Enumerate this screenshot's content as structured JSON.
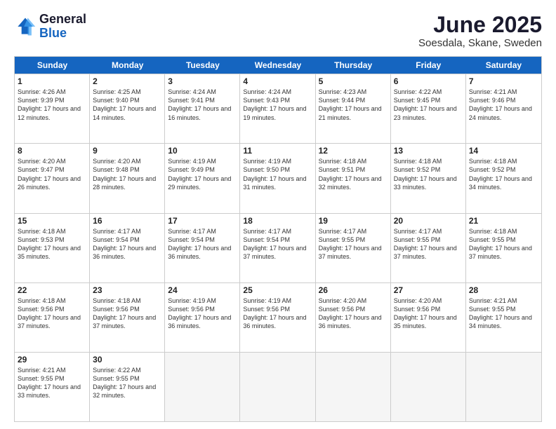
{
  "logo": {
    "general": "General",
    "blue": "Blue"
  },
  "title": "June 2025",
  "location": "Soesdala, Skane, Sweden",
  "weekdays": [
    "Sunday",
    "Monday",
    "Tuesday",
    "Wednesday",
    "Thursday",
    "Friday",
    "Saturday"
  ],
  "weeks": [
    [
      {
        "day": "1",
        "sunrise": "4:26 AM",
        "sunset": "9:39 PM",
        "daylight": "17 hours and 12 minutes."
      },
      {
        "day": "2",
        "sunrise": "4:25 AM",
        "sunset": "9:40 PM",
        "daylight": "17 hours and 14 minutes."
      },
      {
        "day": "3",
        "sunrise": "4:24 AM",
        "sunset": "9:41 PM",
        "daylight": "17 hours and 16 minutes."
      },
      {
        "day": "4",
        "sunrise": "4:24 AM",
        "sunset": "9:43 PM",
        "daylight": "17 hours and 19 minutes."
      },
      {
        "day": "5",
        "sunrise": "4:23 AM",
        "sunset": "9:44 PM",
        "daylight": "17 hours and 21 minutes."
      },
      {
        "day": "6",
        "sunrise": "4:22 AM",
        "sunset": "9:45 PM",
        "daylight": "17 hours and 23 minutes."
      },
      {
        "day": "7",
        "sunrise": "4:21 AM",
        "sunset": "9:46 PM",
        "daylight": "17 hours and 24 minutes."
      }
    ],
    [
      {
        "day": "8",
        "sunrise": "4:20 AM",
        "sunset": "9:47 PM",
        "daylight": "17 hours and 26 minutes."
      },
      {
        "day": "9",
        "sunrise": "4:20 AM",
        "sunset": "9:48 PM",
        "daylight": "17 hours and 28 minutes."
      },
      {
        "day": "10",
        "sunrise": "4:19 AM",
        "sunset": "9:49 PM",
        "daylight": "17 hours and 29 minutes."
      },
      {
        "day": "11",
        "sunrise": "4:19 AM",
        "sunset": "9:50 PM",
        "daylight": "17 hours and 31 minutes."
      },
      {
        "day": "12",
        "sunrise": "4:18 AM",
        "sunset": "9:51 PM",
        "daylight": "17 hours and 32 minutes."
      },
      {
        "day": "13",
        "sunrise": "4:18 AM",
        "sunset": "9:52 PM",
        "daylight": "17 hours and 33 minutes."
      },
      {
        "day": "14",
        "sunrise": "4:18 AM",
        "sunset": "9:52 PM",
        "daylight": "17 hours and 34 minutes."
      }
    ],
    [
      {
        "day": "15",
        "sunrise": "4:18 AM",
        "sunset": "9:53 PM",
        "daylight": "17 hours and 35 minutes."
      },
      {
        "day": "16",
        "sunrise": "4:17 AM",
        "sunset": "9:54 PM",
        "daylight": "17 hours and 36 minutes."
      },
      {
        "day": "17",
        "sunrise": "4:17 AM",
        "sunset": "9:54 PM",
        "daylight": "17 hours and 36 minutes."
      },
      {
        "day": "18",
        "sunrise": "4:17 AM",
        "sunset": "9:54 PM",
        "daylight": "17 hours and 37 minutes."
      },
      {
        "day": "19",
        "sunrise": "4:17 AM",
        "sunset": "9:55 PM",
        "daylight": "17 hours and 37 minutes."
      },
      {
        "day": "20",
        "sunrise": "4:17 AM",
        "sunset": "9:55 PM",
        "daylight": "17 hours and 37 minutes."
      },
      {
        "day": "21",
        "sunrise": "4:18 AM",
        "sunset": "9:55 PM",
        "daylight": "17 hours and 37 minutes."
      }
    ],
    [
      {
        "day": "22",
        "sunrise": "4:18 AM",
        "sunset": "9:56 PM",
        "daylight": "17 hours and 37 minutes."
      },
      {
        "day": "23",
        "sunrise": "4:18 AM",
        "sunset": "9:56 PM",
        "daylight": "17 hours and 37 minutes."
      },
      {
        "day": "24",
        "sunrise": "4:19 AM",
        "sunset": "9:56 PM",
        "daylight": "17 hours and 36 minutes."
      },
      {
        "day": "25",
        "sunrise": "4:19 AM",
        "sunset": "9:56 PM",
        "daylight": "17 hours and 36 minutes."
      },
      {
        "day": "26",
        "sunrise": "4:20 AM",
        "sunset": "9:56 PM",
        "daylight": "17 hours and 36 minutes."
      },
      {
        "day": "27",
        "sunrise": "4:20 AM",
        "sunset": "9:56 PM",
        "daylight": "17 hours and 35 minutes."
      },
      {
        "day": "28",
        "sunrise": "4:21 AM",
        "sunset": "9:55 PM",
        "daylight": "17 hours and 34 minutes."
      }
    ],
    [
      {
        "day": "29",
        "sunrise": "4:21 AM",
        "sunset": "9:55 PM",
        "daylight": "17 hours and 33 minutes."
      },
      {
        "day": "30",
        "sunrise": "4:22 AM",
        "sunset": "9:55 PM",
        "daylight": "17 hours and 32 minutes."
      },
      null,
      null,
      null,
      null,
      null
    ]
  ]
}
